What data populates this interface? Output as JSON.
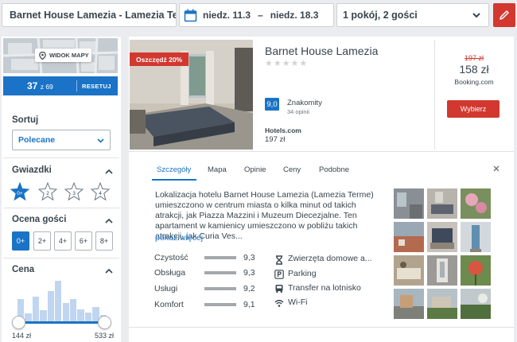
{
  "search": {
    "destination": "Barnet House Lamezia - Lamezia Terme",
    "checkin": "niedz. 11.3",
    "dash": "–",
    "checkout": "niedz. 18.3",
    "guests": "1 pokój, 2 gości"
  },
  "sidebar": {
    "map_button": "WIDOK MAPY",
    "results_count": "37",
    "results_of": "z 69",
    "reset_label": "RESETUJ",
    "sort": {
      "title": "Sortuj",
      "selected": "Polecane"
    },
    "stars": {
      "title": "Gwiazdki",
      "options": [
        "0+",
        "2",
        "3",
        "4"
      ]
    },
    "guest_rating": {
      "title": "Ocena gości",
      "options": [
        "0+",
        "2+",
        "4+",
        "6+",
        "8+"
      ]
    },
    "price": {
      "title": "Cena",
      "min": "144 zł",
      "max": "533 zł",
      "histogram": [
        0.55,
        0.2,
        0.6,
        0.28,
        0.75,
        1.0,
        0.45,
        0.55,
        0.3,
        0.22,
        0.35,
        0.15
      ]
    }
  },
  "hotel": {
    "discount_badge": "Oszczędź 20%",
    "name": "Barnet House Lamezia",
    "stars_glyph": "★★★★★",
    "score": "9,0",
    "score_word": "Znakomity",
    "score_count": "34 opinii",
    "partner_name": "Hotels.com",
    "partner_price": "197 zł",
    "old_price": "197 zł",
    "price": "158 zł",
    "deal_site": "Booking.com",
    "choose_label": "Wybierz"
  },
  "details": {
    "tabs": [
      "Szczegóły",
      "Mapa",
      "Opinie",
      "Ceny",
      "Podobne"
    ],
    "description": "Lokalizacja hotelu Barnet House Lamezia (Lamezia Terme) umieszczono w centrum miasta o kilka minut od takich atrakcji, jak Piazza Mazzini i Muzeum Diecezjalne. Ten apartament w kamienicy umieszczono w pobliżu takich atrakcji, jak Curia Ves...",
    "show_more": "pokaż więcej",
    "criteria": [
      {
        "label": "Czystość",
        "value": "9,3",
        "score": 9.3
      },
      {
        "label": "Obsługa",
        "value": "9,3",
        "score": 9.3
      },
      {
        "label": "Usługi",
        "value": "9,2",
        "score": 9.2
      },
      {
        "label": "Komfort",
        "value": "9,1",
        "score": 9.1
      }
    ],
    "amenities": [
      {
        "label": "Zwierzęta domowe a...",
        "icon": "hourglass-icon"
      },
      {
        "label": "Parking",
        "icon": "parking-icon"
      },
      {
        "label": "Transfer na lotnisko",
        "icon": "shuttle-icon"
      },
      {
        "label": "Wi-Fi",
        "icon": "wifi-icon"
      }
    ]
  },
  "colors": {
    "accent": "#1a73c6",
    "cta": "#d2382f"
  }
}
